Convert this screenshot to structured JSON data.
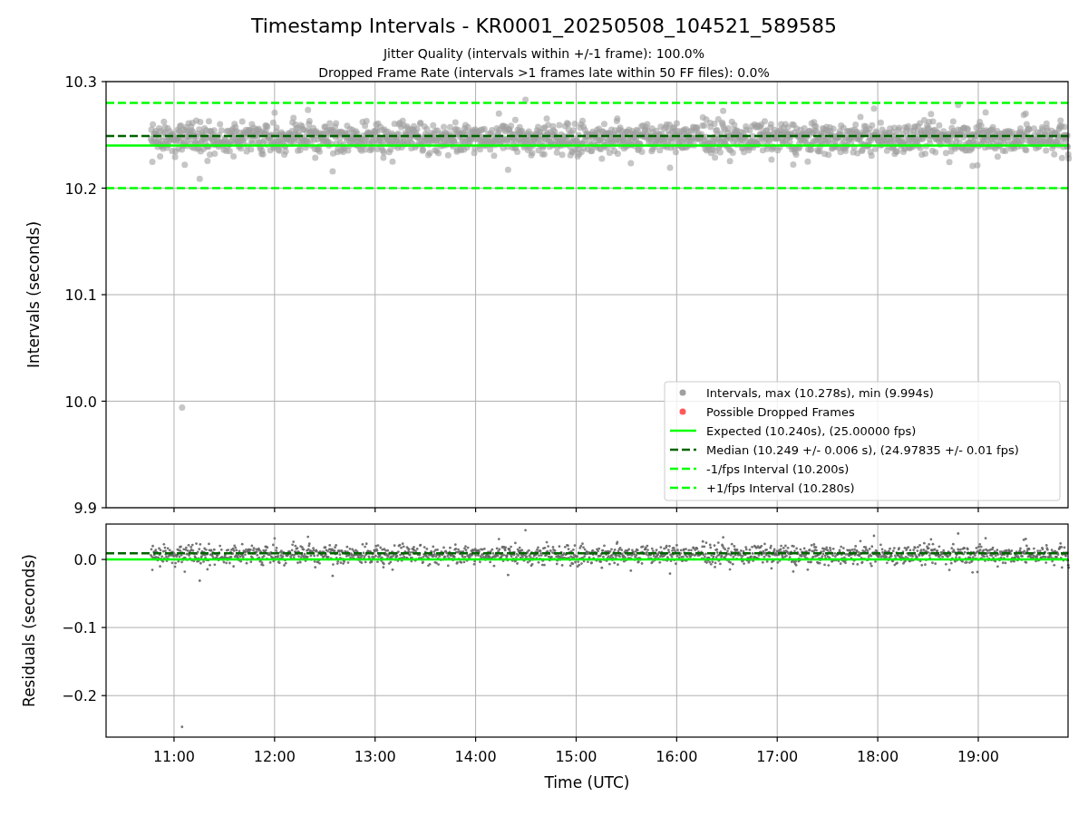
{
  "title": "Timestamp Intervals - KR0001_20250508_104521_589585",
  "subtitles": [
    "Jitter Quality (intervals within +/-1 frame): 100.0%",
    "Dropped Frame Rate (intervals >1 frames late within 50 FF files): 0.0%"
  ],
  "intervals_panel": {
    "legend_markers": [
      {
        "label": "Intervals, max (10.278s), min (9.994s)",
        "color": "#a0a0a0"
      },
      {
        "label": "Possible Dropped Frames",
        "color": "#ff5a5a"
      }
    ],
    "chart_data": {
      "type": "line",
      "ylabel": "Intervals (seconds)",
      "grid": true,
      "legend": true,
      "x": [
        10.324,
        19.893
      ],
      "xlim": [
        10.324,
        19.893
      ],
      "ylim": [
        9.9,
        10.3
      ],
      "yticks": [
        {
          "value": 9.9,
          "label": "9.9"
        },
        {
          "value": 10.0,
          "label": "10.0"
        },
        {
          "value": 10.1,
          "label": "10.1"
        },
        {
          "value": 10.2,
          "label": "10.2"
        },
        {
          "value": 10.3,
          "label": "10.3"
        }
      ],
      "series": [
        {
          "name": "Expected (10.240s), (25.00000 fps)",
          "color": "#00ff00",
          "line_style": "solid",
          "values": [
            10.24,
            10.24
          ]
        },
        {
          "name": "Median (10.249 +/- 0.006 s), (24.97835 +/- 0.01 fps)",
          "color": "#006400",
          "line_style": "dashed",
          "values": [
            10.249,
            10.249
          ]
        },
        {
          "name": "-1/fps Interval (10.200s)",
          "color": "#00ff00",
          "line_style": "dashed",
          "values": [
            10.2,
            10.2
          ]
        },
        {
          "name": "+1/fps Interval (10.280s)",
          "color": "#00ff00",
          "line_style": "dashed",
          "values": [
            10.28,
            10.28
          ]
        }
      ]
    }
  },
  "residuals_panel": {
    "chart_data": {
      "type": "line",
      "xlabel": "Time (UTC)",
      "ylabel": "Residuals (seconds)",
      "grid": true,
      "x": [
        10.324,
        19.893
      ],
      "xlim": [
        10.324,
        19.893
      ],
      "ylim": [
        -0.261,
        0.052
      ],
      "xticks": [
        {
          "value": 11,
          "label": "11:00"
        },
        {
          "value": 12,
          "label": "12:00"
        },
        {
          "value": 13,
          "label": "13:00"
        },
        {
          "value": 14,
          "label": "14:00"
        },
        {
          "value": 15,
          "label": "15:00"
        },
        {
          "value": 16,
          "label": "16:00"
        },
        {
          "value": 17,
          "label": "17:00"
        },
        {
          "value": 18,
          "label": "18:00"
        },
        {
          "value": 19,
          "label": "19:00"
        }
      ],
      "yticks": [
        {
          "value": -0.2,
          "label": "−0.2"
        },
        {
          "value": -0.1,
          "label": "−0.1"
        },
        {
          "value": 0.0,
          "label": "0.0"
        }
      ],
      "series": [
        {
          "color": "#00ff00",
          "line_style": "solid",
          "values": [
            0.0,
            0.0
          ]
        },
        {
          "color": "#006400",
          "line_style": "dashed",
          "values": [
            0.009,
            0.009
          ]
        }
      ]
    }
  }
}
